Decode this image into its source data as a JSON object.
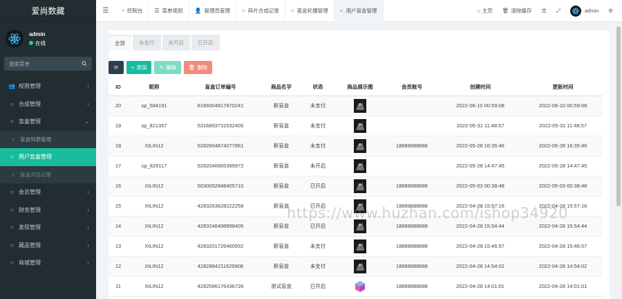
{
  "app": {
    "title": "爱尚数藏"
  },
  "user": {
    "name": "admin",
    "status": "在线"
  },
  "search": {
    "placeholder": "搜索菜单"
  },
  "sidebar": {
    "items": [
      {
        "label": "权限管理",
        "icon": "users-icon",
        "expand": "chevron-left-icon"
      },
      {
        "label": "合成管理",
        "icon": "circle-icon",
        "expand": "chevron-left-icon"
      },
      {
        "label": "盲盒管理",
        "icon": "circle-icon",
        "expand": "chevron-down-icon"
      },
      {
        "label": "盲盒列表管理",
        "icon": "circle-icon",
        "sub": true
      },
      {
        "label": "用户盲盒管理",
        "icon": "circle-icon",
        "active": true
      },
      {
        "label": "盲盒开启记录",
        "icon": "circle-icon",
        "sub": true,
        "dim": true
      },
      {
        "label": "会员管理",
        "icon": "circle-icon",
        "expand": "chevron-left-icon"
      },
      {
        "label": "财务管理",
        "icon": "circle-icon",
        "expand": "chevron-left-icon"
      },
      {
        "label": "发现管理",
        "icon": "circle-icon",
        "expand": "chevron-left-icon"
      },
      {
        "label": "藏品管理",
        "icon": "circle-icon",
        "expand": "chevron-left-icon"
      },
      {
        "label": "商城管理",
        "icon": "circle-icon",
        "expand": "chevron-left-icon"
      }
    ]
  },
  "header": {
    "tabs": [
      {
        "label": "控制台",
        "icon": "dashboard-icon"
      },
      {
        "label": "菜单规则",
        "icon": "list-icon"
      },
      {
        "label": "管理员管理",
        "icon": "user-icon"
      },
      {
        "label": "碎片合成记录",
        "icon": "circle-icon"
      },
      {
        "label": "首盒轮播管理",
        "icon": "circle-icon"
      },
      {
        "label": "用户盲盒管理",
        "icon": "circle-icon",
        "active": true
      }
    ],
    "home_label": "主页",
    "clear_cache_label": "清除缓存",
    "admin_label": "admin"
  },
  "filters": [
    "全部",
    "未支付",
    "未开启",
    "已开启"
  ],
  "toolbar": {
    "add_label": "添加",
    "edit_label": "编辑",
    "delete_label": "删除"
  },
  "table": {
    "headers": [
      "ID",
      "昵称",
      "盲盒订单编号",
      "商品名字",
      "状态",
      "商品展示图",
      "会员账号",
      "创建时间",
      "更新时间"
    ],
    "rows": [
      {
        "id": "20",
        "nick": "sp_584191",
        "order": "6189304817870241",
        "name": "新盲盒",
        "status": "未支付",
        "st": "unpaid",
        "thumb": "dark",
        "account": "",
        "created": "2022-06-10 00:59:08",
        "updated": "2022-06-10 00:59:08"
      },
      {
        "id": "19",
        "nick": "sp_821357",
        "order": "5316893731532405",
        "name": "新盲盒",
        "status": "未支付",
        "st": "unpaid",
        "thumb": "dark",
        "account": "",
        "created": "2022-05-31 11:48:57",
        "updated": "2022-05-31 11:48:57"
      },
      {
        "id": "18",
        "nick": "XILIN12",
        "order": "5282604874077861",
        "name": "新盲盒",
        "status": "未支付",
        "st": "unpaid",
        "thumb": "dark",
        "account": "18888888888",
        "created": "2022-05-28 16:35:46",
        "updated": "2022-05-28 16:35:46"
      },
      {
        "id": "17",
        "nick": "sp_829117",
        "order": "5282046665399972",
        "name": "新盲盒",
        "status": "未开启",
        "st": "unopened",
        "thumb": "dark",
        "account": "",
        "created": "2022-05-28 14:47:45",
        "updated": "2022-05-28 14:47:45"
      },
      {
        "id": "16",
        "nick": "XILIN12",
        "order": "5030052848405710",
        "name": "新盲盒",
        "status": "已开启",
        "st": "opened",
        "thumb": "dark",
        "account": "18888888888",
        "created": "2022-05-03 00:38:48",
        "updated": "2022-05-03 00:38:48"
      },
      {
        "id": "15",
        "nick": "XILIN12",
        "order": "4283263628222258",
        "name": "新盲盒",
        "status": "已开启",
        "st": "opened",
        "thumb": "dark",
        "account": "18888888888",
        "created": "2022-04-28 15:57:16",
        "updated": "2022-04-28 15:57:16"
      },
      {
        "id": "14",
        "nick": "XILIN12",
        "order": "4283248498898405",
        "name": "新盲盒",
        "status": "已开启",
        "st": "opened",
        "thumb": "dark",
        "account": "18888888888",
        "created": "2022-04-28 15:54:44",
        "updated": "2022-04-28 15:54:44"
      },
      {
        "id": "13",
        "nick": "XILIN12",
        "order": "4283201726460932",
        "name": "新盲盒",
        "status": "未支付",
        "st": "unpaid",
        "thumb": "dark",
        "account": "18888888888",
        "created": "2022-04-28 15:46:57",
        "updated": "2022-04-28 15:46:57"
      },
      {
        "id": "12",
        "nick": "XILIN12",
        "order": "4282884211629908",
        "name": "新盲盒",
        "status": "未支付",
        "st": "unpaid",
        "thumb": "dark",
        "account": "18888888888",
        "created": "2022-04-28 14:54:02",
        "updated": "2022-04-28 14:54:02"
      },
      {
        "id": "11",
        "nick": "XILIN12",
        "order": "4282566176436726",
        "name": "测试盲盒",
        "status": "已开启",
        "st": "opened",
        "thumb": "cube",
        "account": "18888888888",
        "created": "2022-04-28 14:01:01",
        "updated": "2022-04-28 14:01:01"
      }
    ]
  },
  "watermark": "https://www.huzhan.com/ishop34920",
  "colors": {
    "accent": "#18bc9c",
    "sidebar_bg": "#222d32",
    "danger": "#e74c3c"
  }
}
